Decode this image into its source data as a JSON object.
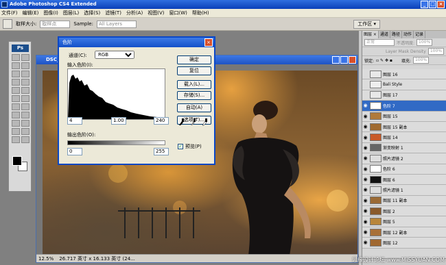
{
  "app": {
    "title": "Adobe Photoshop CS4 Extended"
  },
  "menu": [
    "文件(F)",
    "编辑(E)",
    "图像(I)",
    "图层(L)",
    "选择(S)",
    "滤镜(T)",
    "分析(A)",
    "视图(V)",
    "窗口(W)",
    "帮助(H)"
  ],
  "options": {
    "sample_size_label": "取样大小:",
    "sample_size_value": "取样点",
    "sample_label": "Sample:",
    "sample_value": "All Layers",
    "workspace": "工作区 ▾"
  },
  "document": {
    "title": "DSC_",
    "zoom": "12.5%",
    "size": "26.717 英寸 x 16.133 英寸 (24..."
  },
  "levels_dialog": {
    "title": "色阶",
    "channel_label": "通道(C):",
    "channel_value": "RGB",
    "input_label": "输入色阶(I):",
    "input_black": "4",
    "input_gamma": "1.00",
    "input_white": "240",
    "output_label": "输出色阶(O):",
    "output_black": "0",
    "output_white": "255",
    "buttons": [
      "确定",
      "复位",
      "载入(L)...",
      "存储(S)...",
      "自动(A)",
      "选项(T)..."
    ],
    "preview_label": "预览(P)"
  },
  "layers_panel": {
    "tabs": [
      "图层 ×",
      "通道",
      "路径",
      "动作",
      "记录"
    ],
    "blend_mode": "正常",
    "opacity_label": "不透明度:",
    "opacity_value": "100%",
    "mask_density_label": "Layer Mask Density",
    "mask_density_value": "100%",
    "lock_label": "锁定:",
    "fill_label": "填充:",
    "fill_value": "100%",
    "layers": [
      {
        "name": "图层 16",
        "visible": false,
        "active": false,
        "thumb": "#e8e8e8"
      },
      {
        "name": "Bali Style",
        "visible": false,
        "active": false,
        "thumb": "#eeeeee"
      },
      {
        "name": "图层 17",
        "visible": false,
        "active": false,
        "thumb": "#e8e8e8"
      },
      {
        "name": "色阶 7",
        "visible": true,
        "active": true,
        "thumb": "#ffffff"
      },
      {
        "name": "图层 15",
        "visible": true,
        "active": false,
        "thumb": "#b07a3b"
      },
      {
        "name": "图层 15 副本",
        "visible": true,
        "active": false,
        "thumb": "#a06a30"
      },
      {
        "name": "图层 14",
        "visible": true,
        "active": false,
        "thumb": "#c85a28"
      },
      {
        "name": "渐变映射 1",
        "visible": true,
        "active": false,
        "thumb": "#666666"
      },
      {
        "name": "照片滤镜 2",
        "visible": true,
        "active": false,
        "thumb": "#dddddd"
      },
      {
        "name": "色阶 6",
        "visible": true,
        "active": false,
        "thumb": "#ffffff"
      },
      {
        "name": "图层 6",
        "visible": true,
        "active": false,
        "thumb": "#111111"
      },
      {
        "name": "照片滤镜 1",
        "visible": true,
        "active": false,
        "thumb": "#dddddd"
      },
      {
        "name": "图层 11 副本",
        "visible": true,
        "active": false,
        "thumb": "#9a6a35"
      },
      {
        "name": "图层 2",
        "visible": true,
        "active": false,
        "thumb": "#8a5a2a"
      },
      {
        "name": "图层 5",
        "visible": true,
        "active": false,
        "thumb": "#b8853a"
      },
      {
        "name": "图层 12 副本",
        "visible": true,
        "active": false,
        "thumb": "#a87038"
      },
      {
        "name": "图层 12",
        "visible": true,
        "active": false,
        "thumb": "#a06830"
      }
    ]
  },
  "watermark": "思缘设计论坛 www.MISSYUAN.COM"
}
